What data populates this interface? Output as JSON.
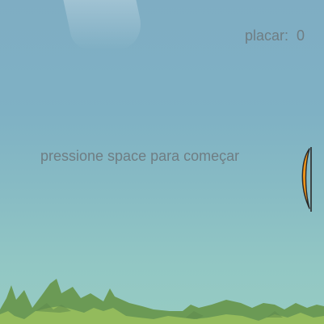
{
  "hud": {
    "score_label": "placar:",
    "score_value": "0"
  },
  "message": {
    "start_prompt": "pressione space para começar"
  },
  "colors": {
    "sky_top": "#7fadc3",
    "sky_bottom": "#96cbc2",
    "text": "#6f7d83",
    "bow_fill": "#f09418",
    "bow_outline": "#2a2a2a",
    "bush_dark": "#6b9a55",
    "bush_light": "#93bb5c"
  },
  "icons": {
    "player": "bow-icon",
    "ground": "bush-foliage"
  }
}
